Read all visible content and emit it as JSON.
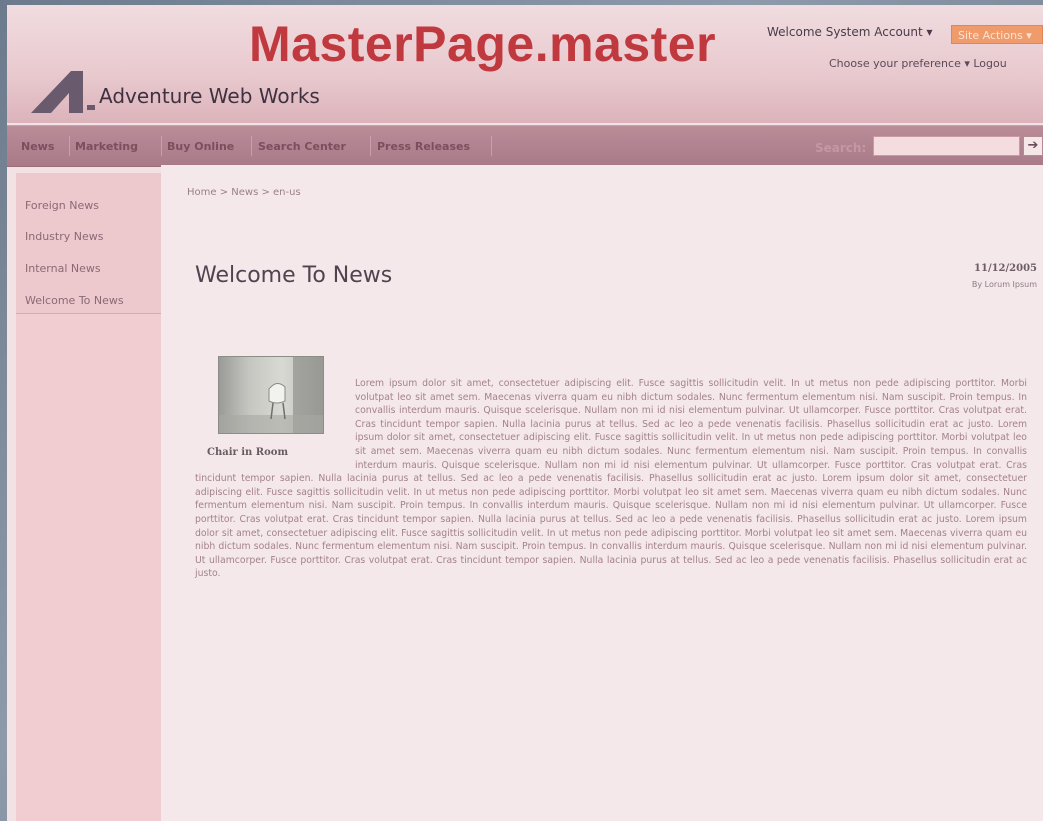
{
  "overlay": {
    "watermark": "MasterPage.master"
  },
  "header": {
    "brand": "Adventure Web Works",
    "welcome": "Welcome System Account ▾",
    "site_actions": "Site Actions ▾",
    "preference": "Choose your preference ▾  Logou"
  },
  "nav": {
    "items": [
      "News",
      "Marketing",
      "Buy Online",
      "Search Center",
      "Press Releases"
    ],
    "search_label": "Search:",
    "search_placeholder": "",
    "search_go": "➔"
  },
  "sidebar": {
    "items": [
      "Foreign News",
      "Industry News",
      "Internal News",
      "Welcome To News"
    ]
  },
  "page": {
    "breadcrumb": "Home > News > en-us",
    "title": "Welcome To News",
    "date": "11/12/2005",
    "byline": "By Lorum Ipsum"
  },
  "article": {
    "image_caption": "Chair in Room",
    "body": "Lorem ipsum dolor sit amet, consectetuer adipiscing elit. Fusce sagittis sollicitudin velit. In ut metus non pede adipiscing porttitor. Morbi volutpat leo sit amet sem. Maecenas viverra quam eu nibh dictum sodales. Nunc fermentum elementum nisi. Nam suscipit. Proin tempus. In convallis interdum mauris. Quisque scelerisque. Nullam non mi id nisi elementum pulvinar. Ut ullamcorper. Fusce porttitor. Cras volutpat erat. Cras tincidunt tempor sapien. Nulla lacinia purus at tellus. Sed ac leo a pede venenatis facilisis. Phasellus sollicitudin erat ac justo. Lorem ipsum dolor sit amet, consectetuer adipiscing elit. Fusce sagittis sollicitudin velit. In ut metus non pede adipiscing porttitor. Morbi volutpat leo sit amet sem. Maecenas viverra quam eu nibh dictum sodales. Nunc fermentum elementum nisi. Nam suscipit. Proin tempus. In convallis interdum mauris. Quisque scelerisque. Nullam non mi id nisi elementum pulvinar. Ut ullamcorper. Fusce porttitor. Cras volutpat erat. Cras tincidunt tempor sapien. Nulla lacinia purus at tellus. Sed ac leo a pede venenatis facilisis. Phasellus sollicitudin erat ac justo. Lorem ipsum dolor sit amet, consectetuer adipiscing elit. Fusce sagittis sollicitudin velit. In ut metus non pede adipiscing porttitor. Morbi volutpat leo sit amet sem. Maecenas viverra quam eu nibh dictum sodales. Nunc fermentum elementum nisi. Nam suscipit. Proin tempus. In convallis interdum mauris. Quisque scelerisque. Nullam non mi id nisi elementum pulvinar. Ut ullamcorper. Fusce porttitor. Cras volutpat erat. Cras tincidunt tempor sapien. Nulla lacinia purus at tellus. Sed ac leo a pede venenatis facilisis. Phasellus sollicitudin erat ac justo. Lorem ipsum dolor sit amet, consectetuer adipiscing elit. Fusce sagittis sollicitudin velit. In ut metus non pede adipiscing porttitor. Morbi volutpat leo sit amet sem. Maecenas viverra quam eu nibh dictum sodales. Nunc fermentum elementum nisi. Nam suscipit. Proin tempus. In convallis interdum mauris. Quisque scelerisque. Nullam non mi id nisi elementum pulvinar. Ut ullamcorper. Fusce porttitor. Cras volutpat erat. Cras tincidunt tempor sapien. Nulla lacinia purus at tellus. Sed ac leo a pede venenatis facilisis. Phasellus sollicitudin erat ac justo."
  },
  "colors": {
    "watermark": "#c0393f",
    "site_actions_bg": "#ef9b6b",
    "nav_bg": "#a97a88",
    "sidebar_bg": "#f1cdd1",
    "content_bg": "#f5e8ea"
  },
  "icons": [
    "logo-a-icon",
    "search-arrow-icon",
    "chair-photo"
  ]
}
